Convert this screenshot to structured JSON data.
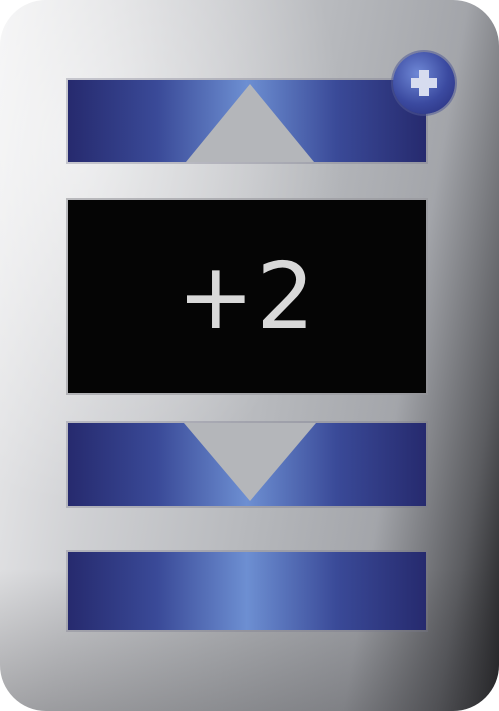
{
  "stepper": {
    "value": "+2"
  },
  "icons": {
    "badge": "plus-badge-icon",
    "increment": "triangle-up-icon",
    "decrement": "triangle-down-icon"
  },
  "colors": {
    "button_dark": "#262a6e",
    "button_light": "#6d8fd2",
    "display_bg": "#050505",
    "display_text": "#d9d9d9",
    "panel_silver": "#b6b8bc"
  }
}
